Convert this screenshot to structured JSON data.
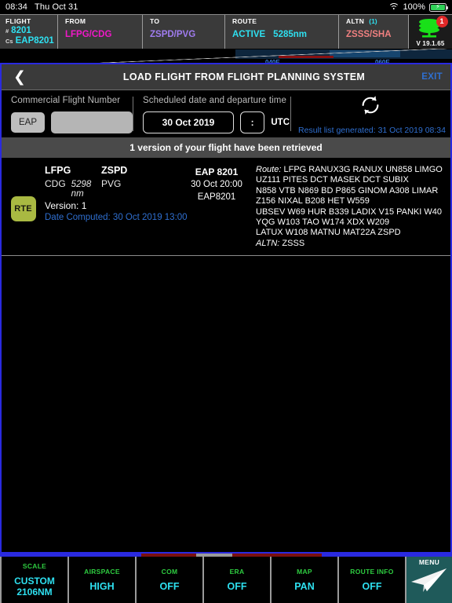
{
  "statusbar": {
    "time": "08:34",
    "date": "Thu Oct 31",
    "battery_pct": "100%",
    "wifi_icon": "wifi-icon",
    "battery_icon": "battery-charging-icon"
  },
  "flight_header": {
    "cells": [
      {
        "label": "FLIGHT",
        "prefix1": "#",
        "value1": "8201",
        "prefix2": "Cs",
        "value2": "EAP8201"
      },
      {
        "label": "FROM",
        "value": "LFPG/CDG"
      },
      {
        "label": "TO",
        "value": "ZSPD/PVG"
      },
      {
        "label": "ROUTE",
        "value": "ACTIVE",
        "value2": "5285nm"
      },
      {
        "label": "ALTN",
        "count": "(1)",
        "value": "ZSSS/SHA"
      }
    ],
    "logo": {
      "badge": "1",
      "version": "V 19.1.65"
    }
  },
  "map_strip": {
    "labels": [
      "040E",
      "060E"
    ]
  },
  "dialog": {
    "back_icon": "back-chevron-icon",
    "title": "LOAD FLIGHT FROM FLIGHT PLANNING SYSTEM",
    "exit_label": "EXIT",
    "form": {
      "flight_number_label": "Commercial Flight Number",
      "airline_prefix": "EAP",
      "flight_number_value": "",
      "schedule_label": "Scheduled date and departure time",
      "date_value": "30 Oct 2019",
      "time_value": ":",
      "time_zone": "UTC",
      "refresh_icon": "refresh-icon",
      "generated_text": "Result list generated: 31 Oct 2019 08:34"
    },
    "banner": "1 version of your flight have been retrieved",
    "results": [
      {
        "badge": "RTE",
        "dep_icao": "LFPG",
        "dep_iata": "CDG",
        "distance": "5298 nm",
        "arr_icao": "ZSPD",
        "arr_iata": "PVG",
        "version_label": "Version:",
        "version_value": "1",
        "date_computed": "Date Computed: 30 Oct 2019 13:00",
        "flight_id": "EAP 8201",
        "flight_dep": "30 Oct 20:00",
        "flight_callsign": "EAP8201",
        "route_label": "Route:",
        "route_lines": [
          "LFPG RANUX3G RANUX UN858 LIMGO",
          "UZ111 PITES DCT MASEK DCT SUBIX",
          "N858 VTB N869 BD P865 GINOM A308 LIMAR",
          "Z156 NIXAL B208 HET W559",
          "UBSEV W69 HUR B339 LADIX V15 PANKI W40",
          "YQG W103 TAO W174 XDX W209",
          "LATUX W108 MATNU MAT22A ZSPD"
        ],
        "altn_label": "ALTN:",
        "altn_value": "ZSSS"
      }
    ]
  },
  "toolbar": {
    "items": [
      {
        "label": "SCALE",
        "value": "CUSTOM\n2106NM"
      },
      {
        "label": "AIRSPACE",
        "value": "HIGH"
      },
      {
        "label": "COM",
        "value": "OFF"
      },
      {
        "label": "ERA",
        "value": "OFF"
      },
      {
        "label": "MAP",
        "value": "PAN"
      },
      {
        "label": "ROUTE INFO",
        "value": "OFF"
      }
    ],
    "menu": {
      "label": "MENU",
      "icon": "paper-plane-icon"
    }
  },
  "colors": {
    "accent_blue": "#2a2ae0",
    "cyan": "#2ee0f0",
    "magenta": "#f018c8",
    "purple": "#a07cf0",
    "salmon": "#f08080",
    "green": "#2ecc40",
    "link_blue": "#2f6fd0",
    "rte_badge": "#a9b942",
    "menu_teal": "#1f5a5a"
  }
}
